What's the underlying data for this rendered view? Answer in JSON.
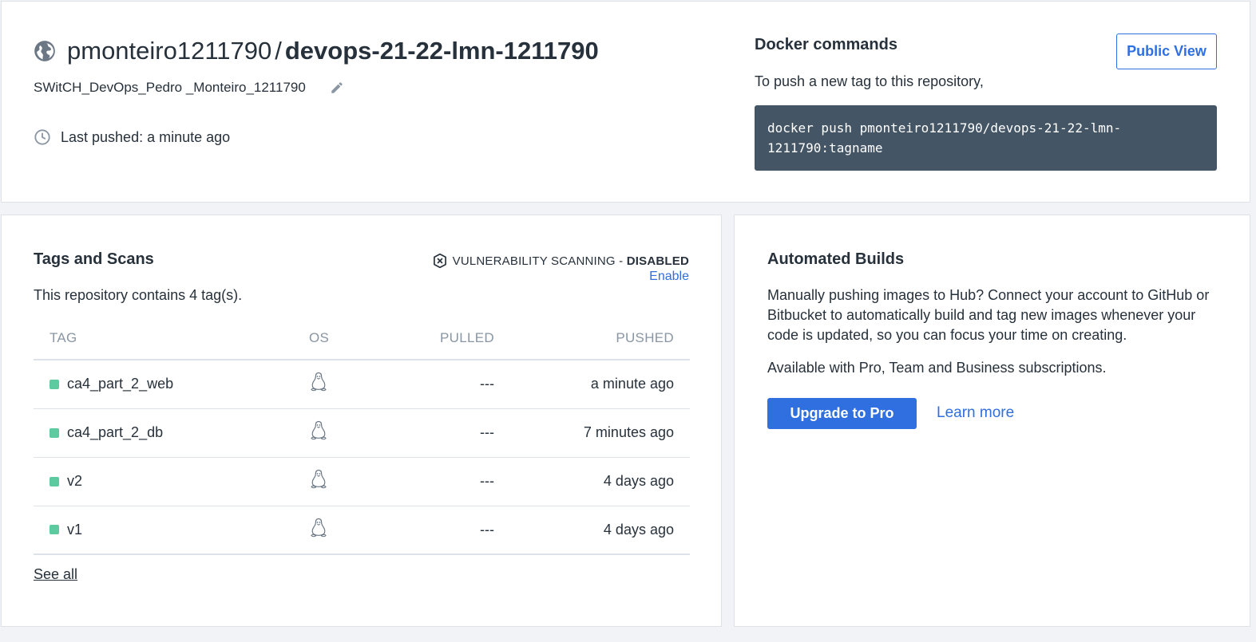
{
  "repo": {
    "owner": "pmonteiro1211790",
    "separator": "/",
    "name": "devops-21-22-lmn-1211790",
    "description": "SWitCH_DevOps_Pedro _Monteiro_1211790",
    "last_pushed": "Last pushed: a minute ago"
  },
  "docker": {
    "title": "Docker commands",
    "subtitle": "To push a new tag to this repository,",
    "command": "docker push pmonteiro1211790/devops-21-22-lmn-1211790:tagname",
    "public_view_label": "Public View"
  },
  "tags": {
    "title": "Tags and Scans",
    "vuln_label": "VULNERABILITY SCANNING - ",
    "vuln_status": "DISABLED",
    "enable_label": "Enable",
    "count_text": "This repository contains 4 tag(s).",
    "columns": {
      "tag": "TAG",
      "os": "OS",
      "pulled": "PULLED",
      "pushed": "PUSHED"
    },
    "rows": [
      {
        "tag": "ca4_part_2_web",
        "os": "linux-icon",
        "pulled": "---",
        "pushed": "a minute ago"
      },
      {
        "tag": "ca4_part_2_db",
        "os": "linux-icon",
        "pulled": "---",
        "pushed": "7 minutes ago"
      },
      {
        "tag": "v2",
        "os": "linux-icon",
        "pulled": "---",
        "pushed": "4 days ago"
      },
      {
        "tag": "v1",
        "os": "linux-icon",
        "pulled": "---",
        "pushed": "4 days ago"
      }
    ],
    "see_all_label": "See all"
  },
  "builds": {
    "title": "Automated Builds",
    "description": "Manually pushing images to Hub? Connect your account to GitHub or Bitbucket to automatically build and tag new images whenever your code is updated, so you can focus your time on creating.",
    "availability": "Available with Pro, Team and Business subscriptions.",
    "upgrade_label": "Upgrade to Pro",
    "learn_more_label": "Learn more"
  },
  "colors": {
    "accent": "#2f6fe0",
    "tag_status": "#5ecaa0",
    "command_bg": "#445566"
  }
}
